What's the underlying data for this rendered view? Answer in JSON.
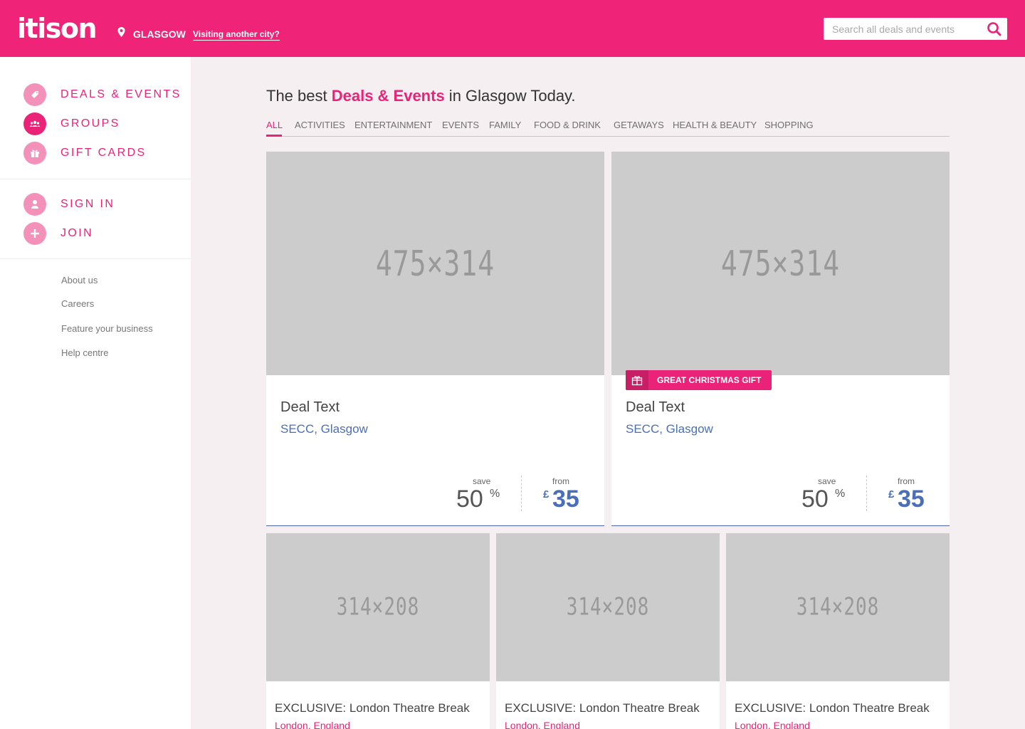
{
  "header": {
    "logo": "itison",
    "city": "GLASGOW",
    "visit_link": "Visiting another city?",
    "search_placeholder": "Search all deals and events",
    "brand_color": "#ef2377"
  },
  "sidebar": {
    "primary": [
      {
        "label": "DEALS & EVENTS",
        "icon": "tag-icon"
      },
      {
        "label": "GROUPS",
        "icon": "people-icon"
      },
      {
        "label": "GIFT CARDS",
        "icon": "gift-icon"
      }
    ],
    "account": [
      {
        "label": "SIGN IN",
        "icon": "user-icon"
      },
      {
        "label": "JOIN",
        "icon": "plus-icon"
      }
    ],
    "links": [
      "About us",
      "Careers",
      "Feature your business",
      "Help centre"
    ]
  },
  "main": {
    "title_pre": "The best ",
    "title_highlight": "Deals & Events",
    "title_post": " in Glasgow Today.",
    "tabs": [
      "ALL",
      "ACTIVITIES",
      "ENTERTAINMENT",
      "EVENTS",
      "FAMILY",
      "FOOD & DRINK",
      "GETAWAYS",
      "HEALTH & BEAUTY",
      "SHOPPING"
    ],
    "active_tab": "ALL",
    "featured": [
      {
        "image_text": "475×314",
        "title": "Deal Text",
        "location": "SECC, Glasgow",
        "save_label": "save",
        "save_value": "50",
        "save_unit": "%",
        "from_label": "from",
        "currency": "£",
        "price": "35"
      },
      {
        "image_text": "475×314",
        "badge": "GREAT CHRISTMAS GIFT",
        "title": "Deal Text",
        "location": "SECC, Glasgow",
        "save_label": "save",
        "save_value": "50",
        "save_unit": "%",
        "from_label": "from",
        "currency": "£",
        "price": "35"
      }
    ],
    "small": [
      {
        "image_text": "314×208",
        "title": "EXCLUSIVE: London Theatre Break",
        "location": "London, England"
      },
      {
        "image_text": "314×208",
        "title": "EXCLUSIVE: London Theatre Break",
        "location": "London, England"
      },
      {
        "image_text": "314×208",
        "title": "EXCLUSIVE: London Theatre Break",
        "location": "London, England"
      }
    ]
  }
}
